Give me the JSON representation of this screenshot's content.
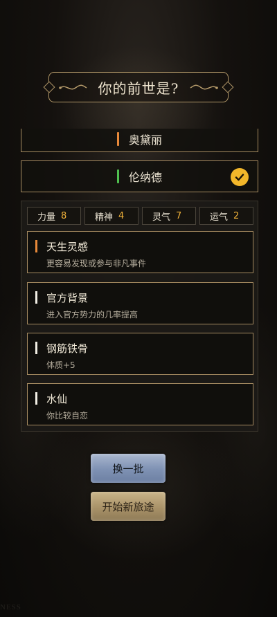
{
  "header": {
    "title": "你的前世是?"
  },
  "names": [
    {
      "label": "奥黛丽",
      "bar_color": "#e8893a",
      "selected": false
    },
    {
      "label": "伦纳德",
      "bar_color": "#4fbf4f",
      "selected": true,
      "check_icon": "checkmark-icon"
    }
  ],
  "stats": [
    {
      "label": "力量",
      "value": "8"
    },
    {
      "label": "精神",
      "value": "4"
    },
    {
      "label": "灵气",
      "value": "7"
    },
    {
      "label": "运气",
      "value": "2"
    }
  ],
  "traits": [
    {
      "name": "天生灵感",
      "desc": "更容易发现或参与非凡事件",
      "bar_color": "#e8893a"
    },
    {
      "name": "官方背景",
      "desc": "进入官方势力的几率提高",
      "bar_color": "#f2efe6"
    },
    {
      "name": "钢筋铁骨",
      "desc": "体质+5",
      "bar_color": "#f2efe6"
    },
    {
      "name": "水仙",
      "desc": "你比较自恋",
      "bar_color": "#f2efe6"
    }
  ],
  "buttons": {
    "refresh_label": "换一批",
    "start_label": "开始新旅途"
  },
  "colors": {
    "accent_gold": "#f2b72a",
    "border_gold": "#a88d62",
    "stat_value": "#f0b23a"
  },
  "watermark": "NESS"
}
